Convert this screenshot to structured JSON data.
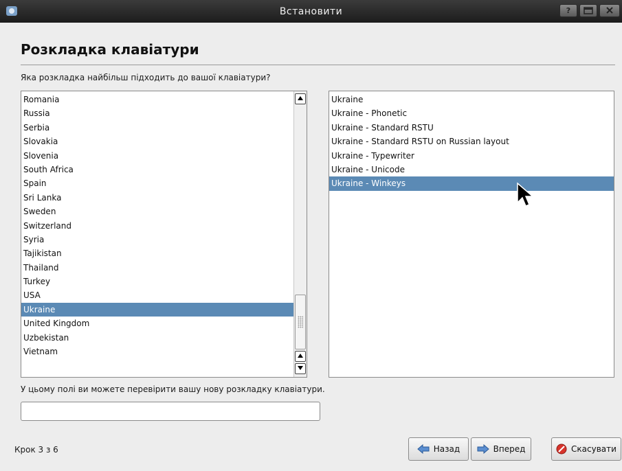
{
  "window": {
    "title": "Встановити",
    "help_button": "?"
  },
  "page": {
    "title": "Розкладка клавіатури",
    "prompt": "Яка розкладка найбільш підходить до вашої клавіатури?",
    "test_hint": "У цьому полі ви можете перевірити вашу нову розкладку клавіатури.",
    "test_input_value": "",
    "step": "Крок 3 з 6"
  },
  "countries": [
    "Romania",
    "Russia",
    "Serbia",
    "Slovakia",
    "Slovenia",
    "South Africa",
    "Spain",
    "Sri Lanka",
    "Sweden",
    "Switzerland",
    "Syria",
    "Tajikistan",
    "Thailand",
    "Turkey",
    "USA",
    "Ukraine",
    "United Kingdom",
    "Uzbekistan",
    "Vietnam"
  ],
  "selected_country": "Ukraine",
  "variants": [
    "Ukraine",
    "Ukraine - Phonetic",
    "Ukraine - Standard RSTU",
    "Ukraine - Standard RSTU on Russian layout",
    "Ukraine - Typewriter",
    "Ukraine - Unicode",
    "Ukraine - Winkeys"
  ],
  "selected_variant": "Ukraine - Winkeys",
  "buttons": {
    "back": "Назад",
    "forward": "Вперед",
    "cancel": "Скасувати"
  },
  "colors": {
    "selection": "#5b8ab5",
    "titlebar": "#2a2a2a"
  },
  "icons": {
    "back": "arrow-left-icon",
    "forward": "arrow-right-icon",
    "cancel": "cancel-icon"
  }
}
